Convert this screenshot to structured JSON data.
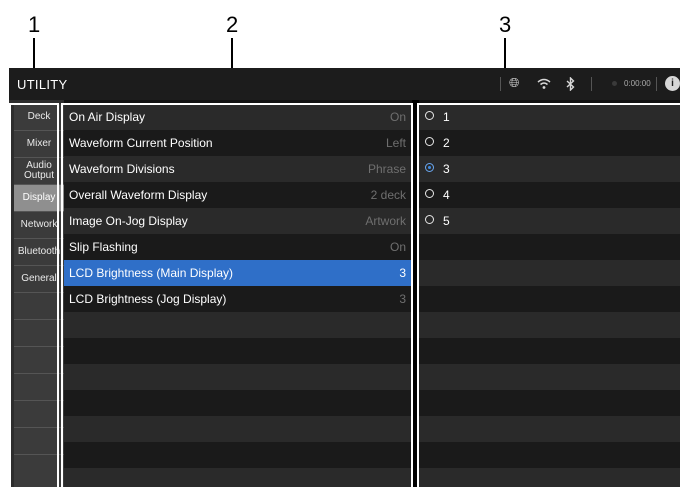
{
  "callouts": [
    "1",
    "2",
    "3"
  ],
  "title": "UTILITY",
  "statusbar": {
    "time": "0:00:00",
    "info_glyph": "i",
    "icons": [
      "globe-icon",
      "wifi-icon",
      "bluetooth-icon"
    ]
  },
  "tabs": [
    {
      "label": "Deck",
      "active": false
    },
    {
      "label": "Mixer",
      "active": false
    },
    {
      "label": "Audio\nOutput",
      "active": false
    },
    {
      "label": "Display",
      "active": true
    },
    {
      "label": "Network",
      "active": false
    },
    {
      "label": "Bluetooth",
      "active": false
    },
    {
      "label": "General",
      "active": false
    }
  ],
  "settings": [
    {
      "label": "On Air Display",
      "value": "On"
    },
    {
      "label": "Waveform Current Position",
      "value": "Left"
    },
    {
      "label": "Waveform Divisions",
      "value": "Phrase"
    },
    {
      "label": "Overall Waveform Display",
      "value": "2 deck"
    },
    {
      "label": "Image On-Jog Display",
      "value": "Artwork"
    },
    {
      "label": "Slip Flashing",
      "value": "On"
    },
    {
      "label": "LCD Brightness (Main Display)",
      "value": "3",
      "selected": true
    },
    {
      "label": "LCD Brightness (Jog Display)",
      "value": "3"
    }
  ],
  "options": [
    {
      "label": "1",
      "checked": false
    },
    {
      "label": "2",
      "checked": false
    },
    {
      "label": "3",
      "checked": true
    },
    {
      "label": "4",
      "checked": false
    },
    {
      "label": "5",
      "checked": false
    }
  ],
  "colors": {
    "selection": "#2f6fc8",
    "radio_on": "#3c8be6",
    "active_tab": "#8f8f8f"
  }
}
